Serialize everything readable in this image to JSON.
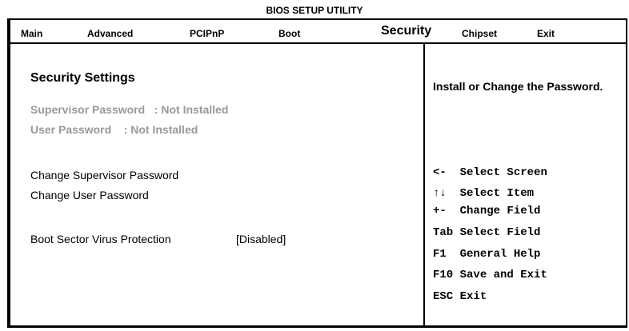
{
  "window_title": "BIOS SETUP UTILITY",
  "menu": {
    "main": "Main",
    "advanced": "Advanced",
    "pcipnp": "PCIPnP",
    "boot": "Boot",
    "security": "Security",
    "chipset": "Chipset",
    "exit": "Exit",
    "active": "Security"
  },
  "settings": {
    "title": "Security Settings",
    "supervisor_status": "Supervisor Password   : Not Installed",
    "user_status": "User Password    : Not Installed",
    "change_supervisor": "Change Supervisor Password",
    "change_user": "Change User Password",
    "boot_virus_label": "Boot Sector Virus Protection",
    "boot_virus_value": "[Disabled]"
  },
  "help": {
    "text": "Install or Change the Password."
  },
  "keys": [
    {
      "key": "<-",
      "action": "Select Screen"
    },
    {
      "key": "↑↓",
      "action": "Select Item"
    },
    {
      "key": "+-",
      "action": "Change Field"
    },
    {
      "key": "Tab",
      "action": "Select Field"
    },
    {
      "key": "F1",
      "action": "General Help"
    },
    {
      "key": "F10",
      "action": "Save and Exit"
    },
    {
      "key": "ESC",
      "action": "Exit"
    }
  ]
}
